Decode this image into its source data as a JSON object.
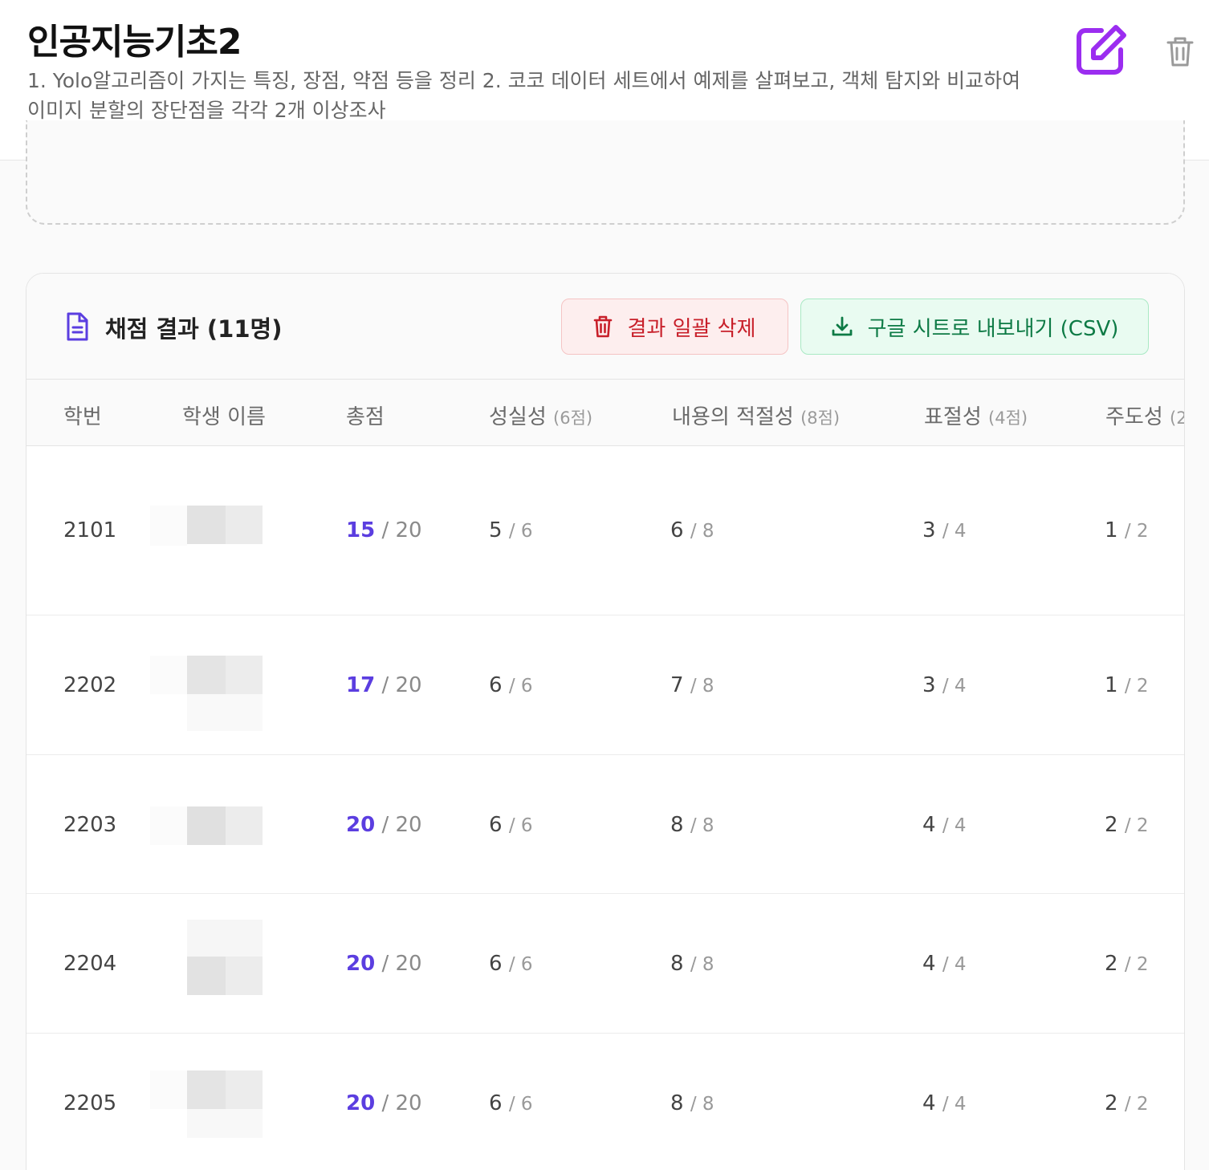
{
  "header": {
    "title": "인공지능기초2",
    "description": "1. Yolo알고리즘이 가지는 특징, 장점, 약점 등을 정리 2. 코코 데이터 세트에서 예제를 살펴보고, 객체 탐지와 비교하여 이미지 분할의 장단점을 각각 2개 이상조사",
    "edit_icon": "edit-icon",
    "delete_icon": "trash-icon",
    "accent_color": "#9b2df0"
  },
  "results": {
    "title": "채점 결과 (11명)",
    "title_icon": "document-icon",
    "delete_all_label": "결과 일괄 삭제",
    "export_label": "구글 시트로 내보내기 (CSV)",
    "columns": [
      {
        "label": "학번",
        "sub": ""
      },
      {
        "label": "학생 이름",
        "sub": ""
      },
      {
        "label": "총점",
        "sub": ""
      },
      {
        "label": "성실성",
        "sub": "(6점)"
      },
      {
        "label": "내용의 적절성",
        "sub": "(8점)"
      },
      {
        "label": "표절성",
        "sub": "(4점)"
      },
      {
        "label": "주도성",
        "sub": "(2"
      }
    ],
    "rows": [
      {
        "id": "2101",
        "total": "15",
        "total_max": "/ 20",
        "c1": "5",
        "c1_max": "/ 6",
        "c2": "6",
        "c2_max": "/ 8",
        "c3": "3",
        "c3_max": "/ 4",
        "c4": "1",
        "c4_max": "/ 2"
      },
      {
        "id": "2202",
        "total": "17",
        "total_max": "/ 20",
        "c1": "6",
        "c1_max": "/ 6",
        "c2": "7",
        "c2_max": "/ 8",
        "c3": "3",
        "c3_max": "/ 4",
        "c4": "1",
        "c4_max": "/ 2"
      },
      {
        "id": "2203",
        "total": "20",
        "total_max": "/ 20",
        "c1": "6",
        "c1_max": "/ 6",
        "c2": "8",
        "c2_max": "/ 8",
        "c3": "4",
        "c3_max": "/ 4",
        "c4": "2",
        "c4_max": "/ 2"
      },
      {
        "id": "2204",
        "total": "20",
        "total_max": "/ 20",
        "c1": "6",
        "c1_max": "/ 6",
        "c2": "8",
        "c2_max": "/ 8",
        "c3": "4",
        "c3_max": "/ 4",
        "c4": "2",
        "c4_max": "/ 2"
      },
      {
        "id": "2205",
        "total": "20",
        "total_max": "/ 20",
        "c1": "6",
        "c1_max": "/ 6",
        "c2": "8",
        "c2_max": "/ 8",
        "c3": "4",
        "c3_max": "/ 4",
        "c4": "2",
        "c4_max": "/ 2"
      }
    ]
  }
}
